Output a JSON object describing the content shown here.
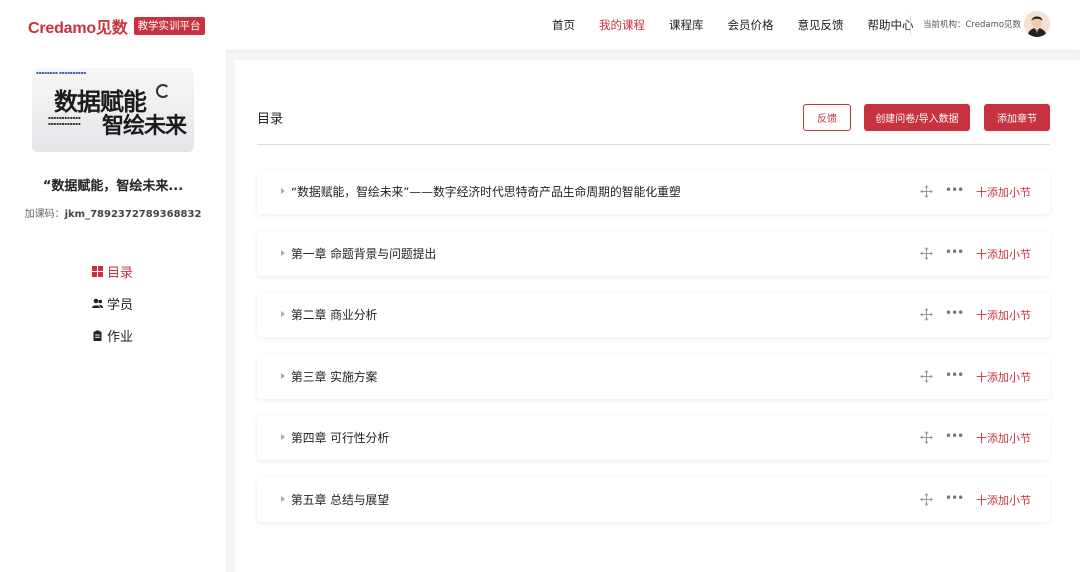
{
  "header": {
    "logo": "Credamo见数",
    "tag": "教学实训平台",
    "nav": [
      "首页",
      "我的课程",
      "课程库",
      "会员价格",
      "意见反馈",
      "帮助中心"
    ],
    "active_nav": "我的课程",
    "org_label": "当前机构：Credamo见数"
  },
  "sidebar": {
    "cover": {
      "big_line1": "数据赋能",
      "big_line2": "智绘未来"
    },
    "course_title": "“数据赋能，智绘未来...",
    "course_code_label": "加课码：",
    "course_code": "jkm_7892372789368832",
    "menu": [
      {
        "label": "目录",
        "icon": "grid-icon",
        "active": true
      },
      {
        "label": "学员",
        "icon": "users-icon",
        "active": false
      },
      {
        "label": "作业",
        "icon": "clipboard-icon",
        "active": false
      }
    ]
  },
  "main": {
    "title": "目录",
    "buttons": {
      "feedback": "反馈",
      "create": "创建问卷/导入数据",
      "add_chapter": "添加章节"
    },
    "chapters": [
      {
        "title": "“数据赋能，智绘未来”——数字经济时代思特奇产品生命周期的智能化重塑",
        "add": "十添加小节"
      },
      {
        "title": "第一章 命题背景与问题提出",
        "add": "十添加小节"
      },
      {
        "title": "第二章 商业分析",
        "add": "十添加小节"
      },
      {
        "title": "第三章 实施方案",
        "add": "十添加小节"
      },
      {
        "title": "第四章 可行性分析",
        "add": "十添加小节"
      },
      {
        "title": "第五章 总结与展望",
        "add": "十添加小节"
      }
    ]
  },
  "colors": {
    "brand": "#c7323f",
    "background": "#f5f5f7"
  }
}
